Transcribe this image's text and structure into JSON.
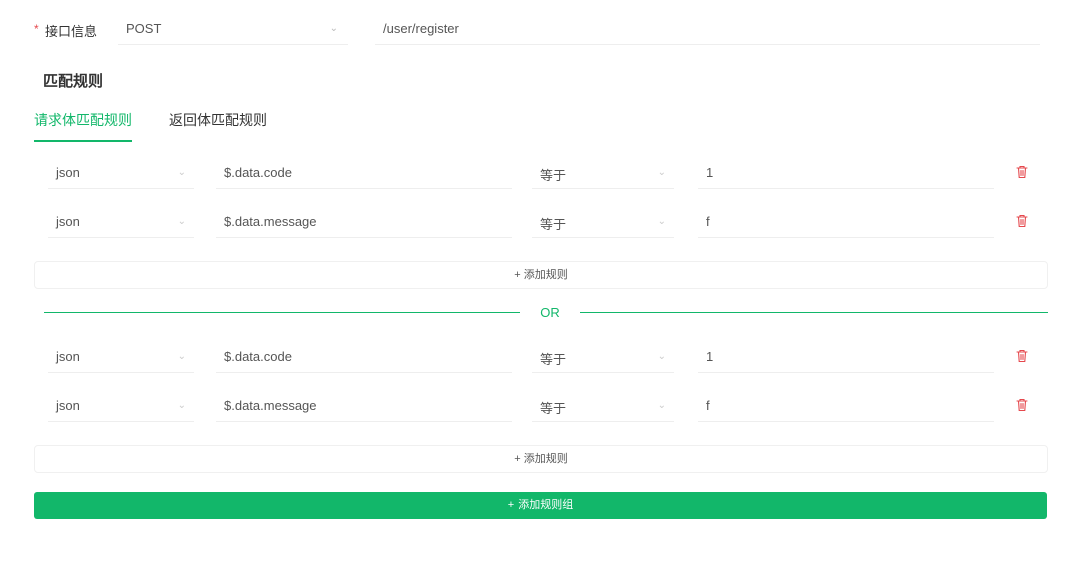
{
  "header": {
    "required_mark": "*",
    "label": "接口信息",
    "method": "POST",
    "path": "/user/register"
  },
  "section": {
    "title": "匹配规则"
  },
  "tabs": [
    {
      "label": "请求体匹配规则",
      "active": true
    },
    {
      "label": "返回体匹配规则",
      "active": false
    }
  ],
  "groups": [
    {
      "rules": [
        {
          "type": "json",
          "path": "$.data.code",
          "operator": "等于",
          "value": "1"
        },
        {
          "type": "json",
          "path": "$.data.message",
          "operator": "等于",
          "value": "f"
        }
      ],
      "add_rule_label": "添加规则"
    },
    {
      "rules": [
        {
          "type": "json",
          "path": "$.data.code",
          "operator": "等于",
          "value": "1"
        },
        {
          "type": "json",
          "path": "$.data.message",
          "operator": "等于",
          "value": "f"
        }
      ],
      "add_rule_label": "添加规则"
    }
  ],
  "or_separator": "OR",
  "add_group_label": "添加规则组",
  "colors": {
    "accent": "#12b76a",
    "danger": "#e5484d"
  },
  "icons": {
    "delete": "trash-icon",
    "dropdown": "chevron-down-icon",
    "add": "plus-icon"
  }
}
